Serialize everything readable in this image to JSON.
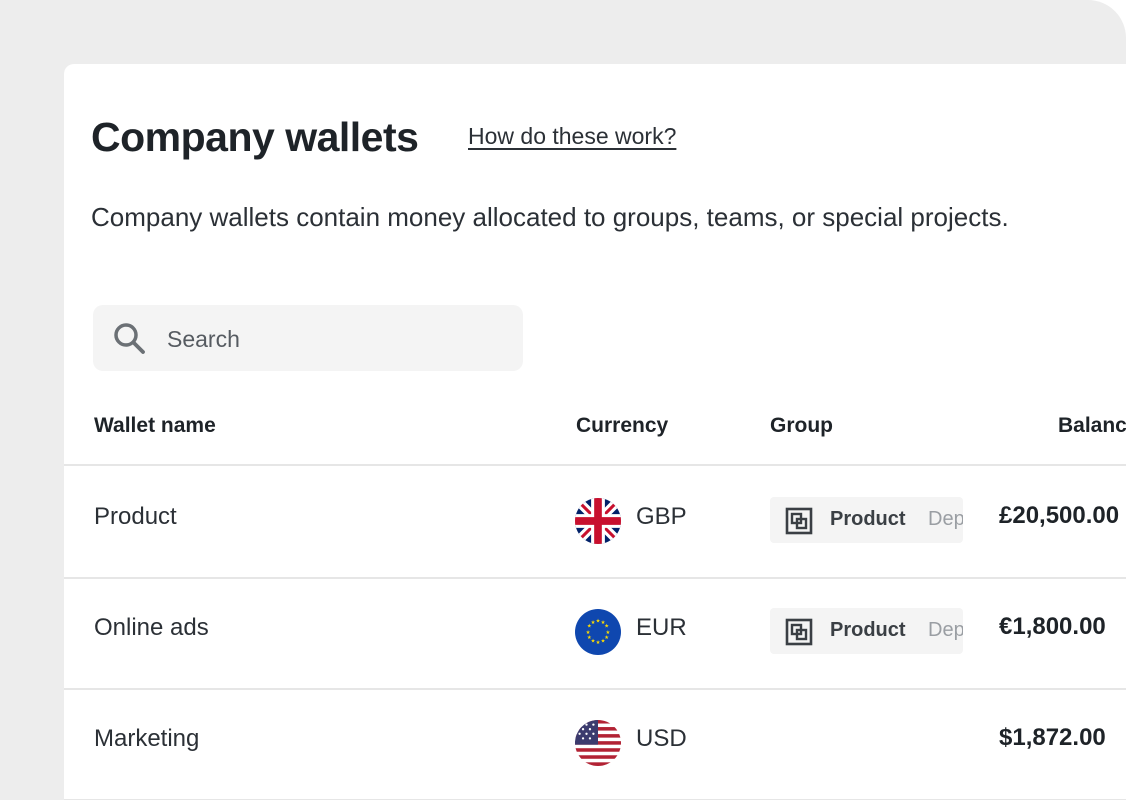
{
  "header": {
    "title": "Company wallets",
    "help_link": "How do these work?",
    "description": "Company wallets contain money allocated to groups, teams, or special projects."
  },
  "search": {
    "placeholder": "Search",
    "icon": "search-icon"
  },
  "table": {
    "columns": [
      "Wallet name",
      "Currency",
      "Group",
      "Balance"
    ],
    "rows": [
      {
        "name": "Product",
        "currency": "GBP",
        "flag": "uk-flag-icon",
        "group": "Product",
        "group_sub": "Dep",
        "balance": "£20,500.00"
      },
      {
        "name": "Online ads",
        "currency": "EUR",
        "flag": "eu-flag-icon",
        "group": "Product",
        "group_sub": "Dep",
        "balance": "€1,800.00"
      },
      {
        "name": "Marketing",
        "currency": "USD",
        "flag": "us-flag-icon",
        "group": "",
        "group_sub": "",
        "balance": "$1,872.00"
      }
    ]
  },
  "colors": {
    "background": "#ededed",
    "card": "#ffffff",
    "text": "#1e2328",
    "chip_bg": "#f4f4f4",
    "divider": "#e6e6e6"
  }
}
